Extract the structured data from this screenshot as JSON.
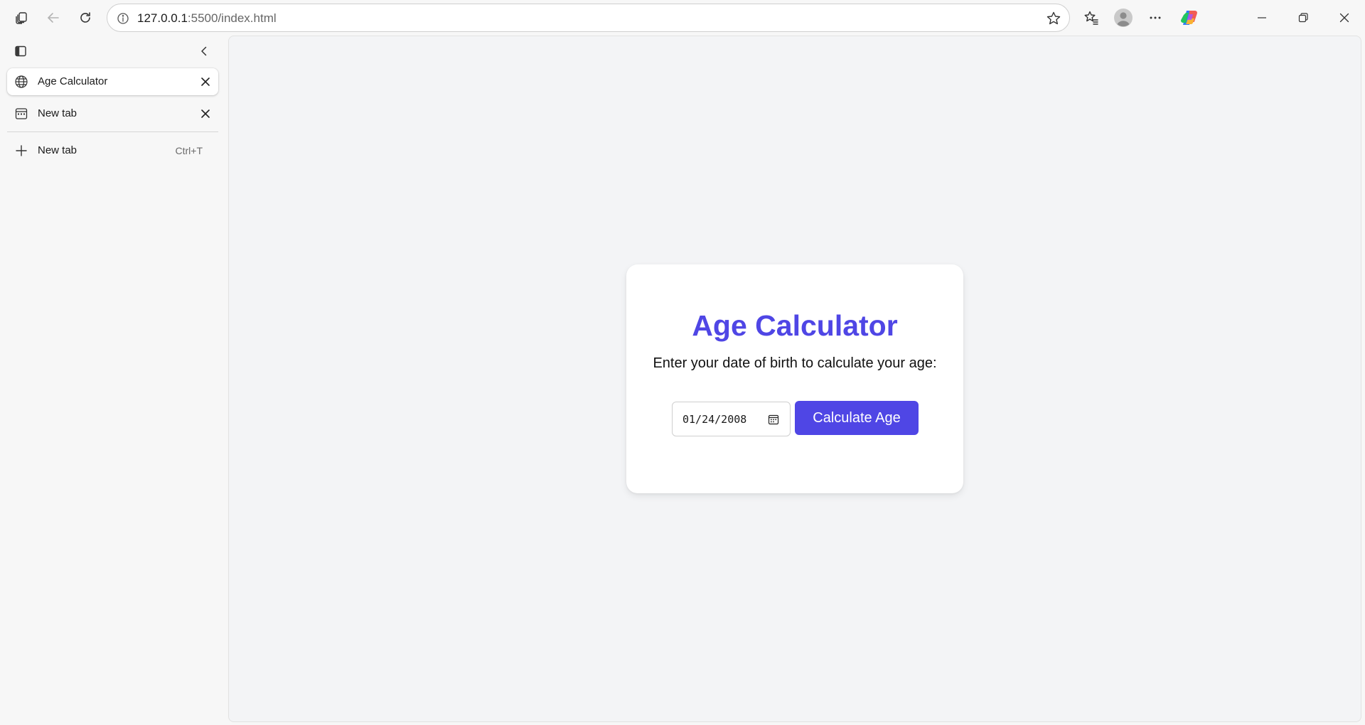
{
  "browser": {
    "address_bar": {
      "url_host": "127.0.0.1",
      "url_rest": ":5500/index.html"
    }
  },
  "sidebar": {
    "tabs": [
      {
        "label": "Age Calculator",
        "icon": "globe-icon",
        "active": true
      },
      {
        "label": "New tab",
        "icon": "new-tab-page-icon",
        "active": false
      }
    ],
    "new_tab": {
      "label": "New tab",
      "shortcut": "Ctrl+T"
    }
  },
  "page": {
    "title": "Age Calculator",
    "subtitle": "Enter your date of birth to calculate your age:",
    "date_input": {
      "value": "01/24/2008"
    },
    "calculate_button_label": "Calculate Age"
  },
  "colors": {
    "accent": "#4f46e5",
    "page_background": "#f3f4f6",
    "card_background": "#ffffff",
    "browser_chrome": "#f7f7f7"
  }
}
